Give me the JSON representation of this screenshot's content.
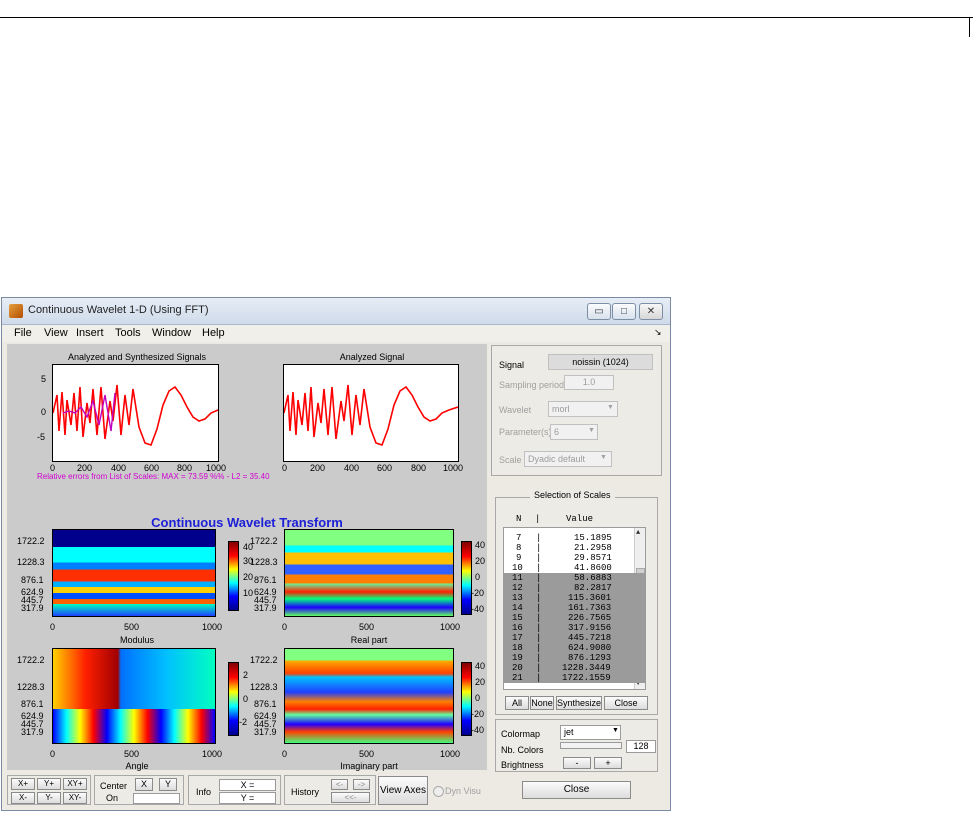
{
  "window": {
    "title": "Continuous Wavelet 1-D (Using FFT)",
    "controls": {
      "minimize": "▭",
      "maximize": "□",
      "close": "✕"
    }
  },
  "menu": [
    "File",
    "View",
    "Insert",
    "Tools",
    "Window",
    "Help"
  ],
  "plots": {
    "synth_title": "Analyzed and Synthesized Signals",
    "analyzed_title": "Analyzed Signal",
    "error_text": "Relative errors from List of Scales: MAX = 73.59 %% - L2 = 35.40",
    "cwt_title": "Continuous Wavelet Transform",
    "y_ticks_signal": [
      "5",
      "0",
      "-5"
    ],
    "x_ticks_signal": [
      "0",
      "200",
      "400",
      "600",
      "800",
      "1000"
    ],
    "scale_ticks": [
      "1722.2",
      "1228.3",
      "876.1",
      "624.9",
      "445.7",
      "317.9"
    ],
    "x_ticks_cwt": [
      "0",
      "500",
      "1000"
    ],
    "cbar_modulus": [
      "40",
      "30",
      "20",
      "10"
    ],
    "cbar_signed": [
      "40",
      "20",
      "0",
      "-20",
      "-40"
    ],
    "cbar_angle": [
      "2",
      "0",
      "-2"
    ],
    "labels": {
      "modulus": "Modulus",
      "real": "Real part",
      "angle": "Angle",
      "imag": "Imaginary part"
    }
  },
  "signal_panel": {
    "signal_label": "Signal",
    "signal_value": "noissin  (1024)",
    "sampling_label": "Sampling period",
    "sampling_value": "1.0",
    "wavelet_label": "Wavelet",
    "wavelet_value": "morl",
    "param_label": "Parameter(s)",
    "param_value": "6",
    "scale_label": "Scale",
    "scale_value": "Dyadic default"
  },
  "scales": {
    "title": "Selection of Scales",
    "header_n": "N",
    "header_sep": "|",
    "header_value": "Value",
    "rows": [
      {
        "n": "7",
        "value": "15.1895",
        "selected": false
      },
      {
        "n": "8",
        "value": "21.2958",
        "selected": false
      },
      {
        "n": "9",
        "value": "29.8571",
        "selected": false
      },
      {
        "n": "10",
        "value": "41.8600",
        "selected": false
      },
      {
        "n": "11",
        "value": "58.6883",
        "selected": true
      },
      {
        "n": "12",
        "value": "82.2817",
        "selected": true
      },
      {
        "n": "13",
        "value": "115.3601",
        "selected": true
      },
      {
        "n": "14",
        "value": "161.7363",
        "selected": true
      },
      {
        "n": "15",
        "value": "226.7565",
        "selected": true
      },
      {
        "n": "16",
        "value": "317.9156",
        "selected": true
      },
      {
        "n": "17",
        "value": "445.7218",
        "selected": true
      },
      {
        "n": "18",
        "value": "624.9080",
        "selected": true
      },
      {
        "n": "19",
        "value": "876.1293",
        "selected": true
      },
      {
        "n": "20",
        "value": "1228.3449",
        "selected": true
      },
      {
        "n": "21",
        "value": "1722.1559",
        "selected": true
      }
    ],
    "btn_all": "All",
    "btn_none": "None",
    "btn_synth": "Synthesize",
    "btn_close": "Close"
  },
  "color_panel": {
    "colormap_label": "Colormap",
    "colormap_value": "jet",
    "ncolors_label": "Nb. Colors",
    "ncolors_value": "128",
    "brightness_label": "Brightness",
    "minus": "-",
    "plus": "+"
  },
  "bottom": {
    "zoom": [
      "X+",
      "Y+",
      "XY+",
      "X-",
      "Y-",
      "XY-"
    ],
    "center_label": "Center",
    "on_label": "On",
    "center_x": "X",
    "center_y": "Y",
    "info_label": "Info",
    "x_field": "X =",
    "y_field": "Y =",
    "history_label": "History",
    "hist_prev": "<-",
    "hist_next": "->",
    "hist_first": "<<-",
    "view_axes": "View Axes",
    "dyn_visu": "Dyn Visu",
    "close_main": "Close"
  },
  "colors": {
    "cwt_title": "#1d20d6",
    "error_text": "#d200d2",
    "signal": "#ff0000",
    "synth": "#c000c0"
  }
}
